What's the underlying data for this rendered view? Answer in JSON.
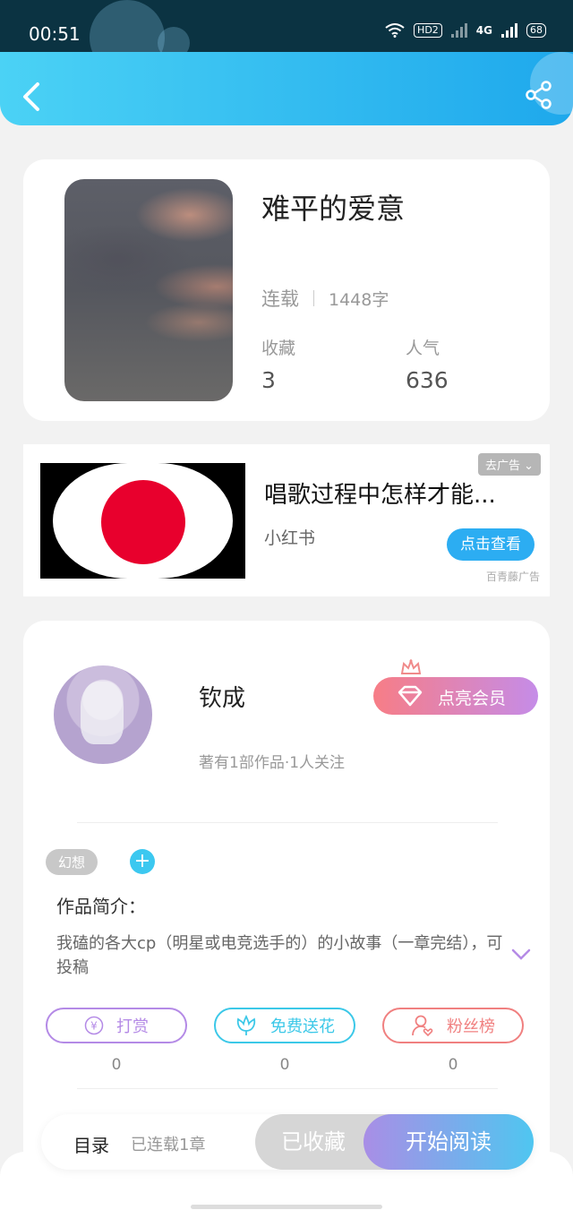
{
  "status_bar": {
    "time": "00:51",
    "hd_badge": "HD2",
    "network_badge": "4G",
    "battery": "68"
  },
  "header": {
    "back_icon": "chevron-left-icon",
    "share_icon": "share-icon"
  },
  "book": {
    "title": "难平的爱意",
    "status": "连载",
    "word_count": "1448字",
    "favorites_label": "收藏",
    "favorites_value": "3",
    "popularity_label": "人气",
    "popularity_value": "636"
  },
  "ad": {
    "title": "唱歌过程中怎样才能...",
    "source": "小红书",
    "close_label": "去广告",
    "cta_label": "点击查看",
    "brand": "百青藤广告"
  },
  "author": {
    "name": "钦成",
    "meta": "著有1部作品·1人关注",
    "vip_label": "点亮会员"
  },
  "details": {
    "tag": "幻想",
    "tag_add": "+",
    "intro_heading": "作品简介：",
    "intro_text": "我磕的各大cp（明星或电竞选手的）的小故事（一章完结），可投稿",
    "actions": [
      {
        "label": "打赏",
        "count": "0",
        "color": "#b48ae6",
        "icon": "yen-icon"
      },
      {
        "label": "免费送花",
        "count": "0",
        "color": "#3cc8e8",
        "icon": "flower-icon"
      },
      {
        "label": "粉丝榜",
        "count": "0",
        "color": "#f08080",
        "icon": "fan-user-icon"
      }
    ]
  },
  "bottom_bar": {
    "toc_label": "目录",
    "toc_status": "已连载1章",
    "collected_label": "已收藏",
    "read_label": "开始阅读"
  }
}
